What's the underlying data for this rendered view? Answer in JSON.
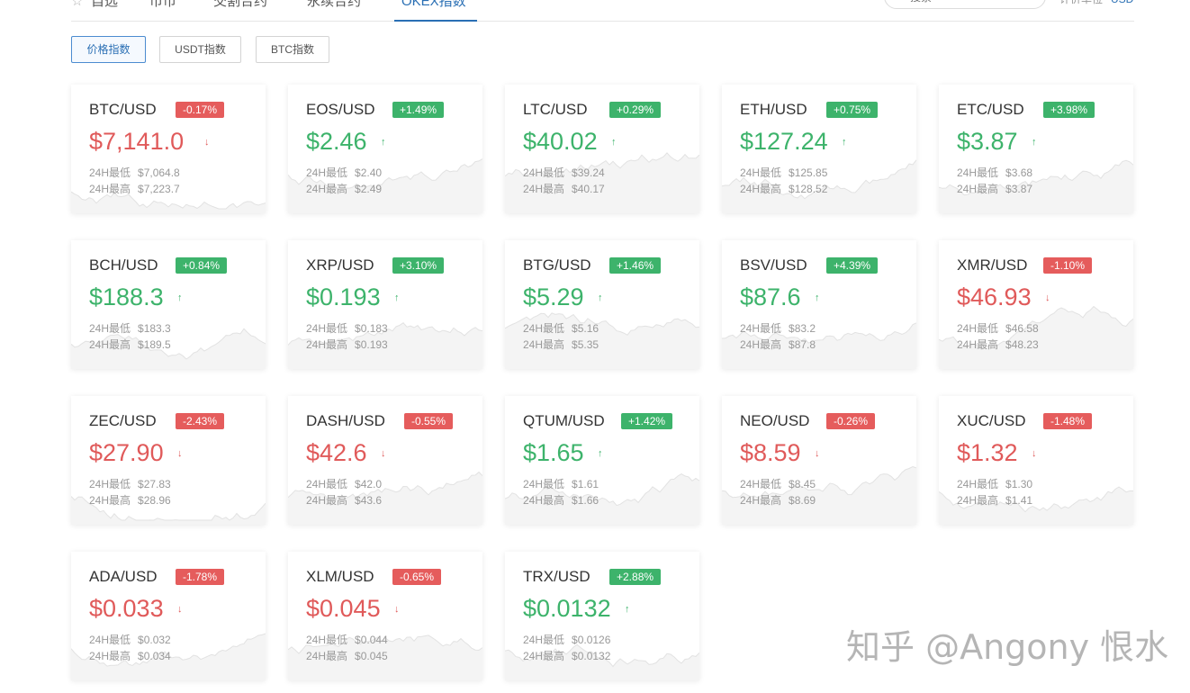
{
  "nav": {
    "tabs": [
      {
        "label": "自选"
      },
      {
        "label": "币币"
      },
      {
        "label": "交割合约"
      },
      {
        "label": "永续合约"
      },
      {
        "label": "OKEX指数"
      }
    ],
    "active_tab": "OKEX指数",
    "search_placeholder": "搜索",
    "unit_label": "计价单位",
    "unit_value": "USD"
  },
  "subtabs": [
    {
      "label": "价格指数",
      "active": true
    },
    {
      "label": "USDT指数",
      "active": false
    },
    {
      "label": "BTC指数",
      "active": false
    }
  ],
  "stat_labels": {
    "low": "24H最低",
    "high": "24H最高"
  },
  "cards": [
    {
      "pair": "BTC/USD",
      "change": "-0.17%",
      "trend": "down",
      "price": "$7,141.0",
      "low": "$7,064.8",
      "high": "$7,223.7"
    },
    {
      "pair": "EOS/USD",
      "change": "+1.49%",
      "trend": "up",
      "price": "$2.46",
      "low": "$2.40",
      "high": "$2.49"
    },
    {
      "pair": "LTC/USD",
      "change": "+0.29%",
      "trend": "up",
      "price": "$40.02",
      "low": "$39.24",
      "high": "$40.17"
    },
    {
      "pair": "ETH/USD",
      "change": "+0.75%",
      "trend": "up",
      "price": "$127.24",
      "low": "$125.85",
      "high": "$128.52"
    },
    {
      "pair": "ETC/USD",
      "change": "+3.98%",
      "trend": "up",
      "price": "$3.87",
      "low": "$3.68",
      "high": "$3.87"
    },
    {
      "pair": "BCH/USD",
      "change": "+0.84%",
      "trend": "up",
      "price": "$188.3",
      "low": "$183.3",
      "high": "$189.5"
    },
    {
      "pair": "XRP/USD",
      "change": "+3.10%",
      "trend": "up",
      "price": "$0.193",
      "low": "$0.183",
      "high": "$0.193"
    },
    {
      "pair": "BTG/USD",
      "change": "+1.46%",
      "trend": "up",
      "price": "$5.29",
      "low": "$5.16",
      "high": "$5.35"
    },
    {
      "pair": "BSV/USD",
      "change": "+4.39%",
      "trend": "up",
      "price": "$87.6",
      "low": "$83.2",
      "high": "$87.8"
    },
    {
      "pair": "XMR/USD",
      "change": "-1.10%",
      "trend": "down",
      "price": "$46.93",
      "low": "$46.58",
      "high": "$48.23"
    },
    {
      "pair": "ZEC/USD",
      "change": "-2.43%",
      "trend": "down",
      "price": "$27.90",
      "low": "$27.83",
      "high": "$28.96"
    },
    {
      "pair": "DASH/USD",
      "change": "-0.55%",
      "trend": "down",
      "price": "$42.6",
      "low": "$42.0",
      "high": "$43.6"
    },
    {
      "pair": "QTUM/USD",
      "change": "+1.42%",
      "trend": "up",
      "price": "$1.65",
      "low": "$1.61",
      "high": "$1.66"
    },
    {
      "pair": "NEO/USD",
      "change": "-0.26%",
      "trend": "down",
      "price": "$8.59",
      "low": "$8.45",
      "high": "$8.69"
    },
    {
      "pair": "XUC/USD",
      "change": "-1.48%",
      "trend": "down",
      "price": "$1.32",
      "low": "$1.30",
      "high": "$1.41"
    },
    {
      "pair": "ADA/USD",
      "change": "-1.78%",
      "trend": "down",
      "price": "$0.033",
      "low": "$0.032",
      "high": "$0.034"
    },
    {
      "pair": "XLM/USD",
      "change": "-0.65%",
      "trend": "down",
      "price": "$0.045",
      "low": "$0.044",
      "high": "$0.045"
    },
    {
      "pair": "TRX/USD",
      "change": "+2.88%",
      "trend": "up",
      "price": "$0.0132",
      "low": "$0.0126",
      "high": "$0.0132"
    }
  ],
  "colors": {
    "up": "#3db36b",
    "down": "#e05a5a",
    "accent": "#2a6fb4"
  },
  "watermark": "知乎 @Angony 恨水"
}
